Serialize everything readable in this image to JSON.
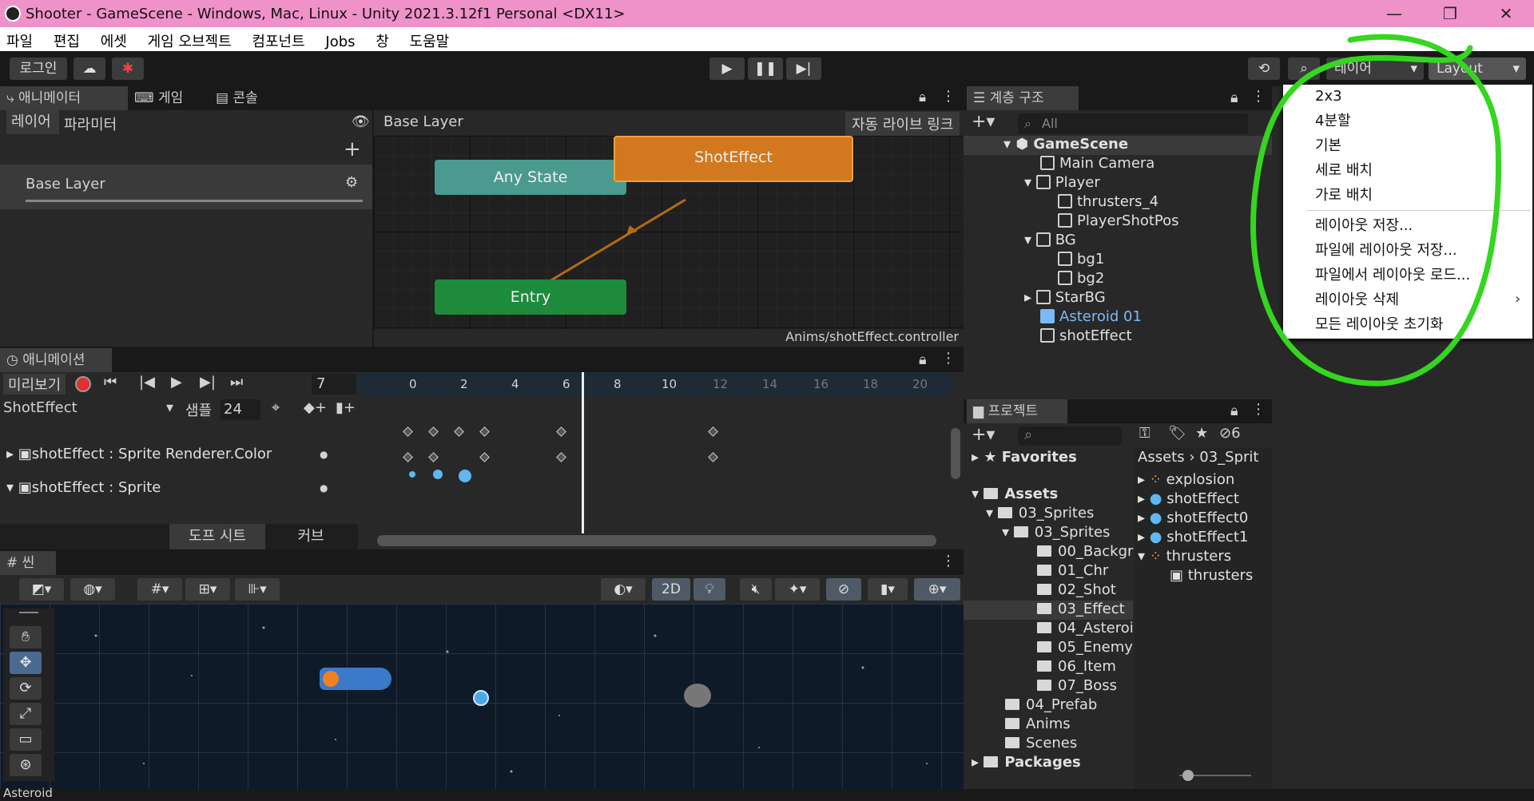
{
  "title_bar": {
    "title": "Shooter - GameScene - Windows, Mac, Linux - Unity 2021.3.12f1 Personal <DX11>",
    "minimize": "—",
    "maximize": "❐",
    "close": "✕"
  },
  "menu": [
    "파일",
    "편집",
    "에셋",
    "게임 오브젝트",
    "컴포넌트",
    "Jobs",
    "창",
    "도움말"
  ],
  "toolbar": {
    "login": "로그인",
    "layers_label": "레이어",
    "layout_label": "Layout"
  },
  "animator": {
    "tabs": [
      "애니메이터",
      "게임",
      "콘솔"
    ],
    "subtabs": [
      "레이어",
      "파라미터"
    ],
    "layer_name": "Base Layer",
    "breadcrumb": "Base Layer",
    "auto_live_link": "자동 라이브 링크",
    "nodes": {
      "any_state": "Any State",
      "shot_effect": "ShotEffect",
      "entry": "Entry"
    },
    "controller_path": "Anims/shotEffect.controller"
  },
  "hierarchy": {
    "tab": "계층 구조",
    "search_placeholder": "All",
    "items": [
      "GameScene",
      "Main Camera",
      "Player",
      "thrusters_4",
      "PlayerShotPos",
      "BG",
      "bg1",
      "bg2",
      "StarBG",
      "Asteroid 01",
      "shotEffect"
    ]
  },
  "layout_menu": {
    "items": [
      "2x3",
      "4분할",
      "기본",
      "세로 배치",
      "가로 배치",
      "레이아웃 저장...",
      "파일에 레이아웃 저장...",
      "파일에서 레이아웃 로드...",
      "레이아웃 삭제",
      "모든 레이아웃 초기화"
    ],
    "submenu_arrow": "›"
  },
  "animation": {
    "tab": "애니메이션",
    "preview": "미리보기",
    "frame": "7",
    "clip": "ShotEffect",
    "samples_label": "샘플",
    "samples": "24",
    "ticks": [
      "0",
      "2",
      "4",
      "6",
      "8",
      "10",
      "12",
      "14",
      "16",
      "18",
      "20"
    ],
    "properties": [
      "shotEffect : Sprite Renderer.Color",
      "shotEffect : Sprite"
    ],
    "bottom_tabs": [
      "도프 시트",
      "커브"
    ]
  },
  "project": {
    "tab": "프로젝트",
    "hidden_count": "6",
    "favorites": "Favorites",
    "assets": "Assets",
    "breadcrumb": [
      "Assets",
      "03_Sprit"
    ],
    "tree": [
      "03_Sprites",
      "03_Sprites",
      "00_Backgr",
      "01_Chr",
      "02_Shot",
      "03_Effect",
      "04_Asteroi",
      "05_Enemy",
      "06_Item",
      "07_Boss",
      "04_Prefab",
      "Anims",
      "Scenes"
    ],
    "packages": "Packages",
    "files": [
      "explosion",
      "shotEffect",
      "shotEffect0",
      "shotEffect1",
      "thrusters",
      "thrusters"
    ]
  },
  "scene": {
    "tab": "씬",
    "mode_2d": "2D"
  },
  "status": {
    "text": "Asteroid"
  },
  "colors": {
    "title_bg": "#ef92c9",
    "highlight_ring": "#35d620",
    "selected_blue": "#7cb9f5",
    "orange_node": "#d2781e",
    "entry_green": "#1e8a3c",
    "any_state_teal": "#4a9a8f"
  }
}
